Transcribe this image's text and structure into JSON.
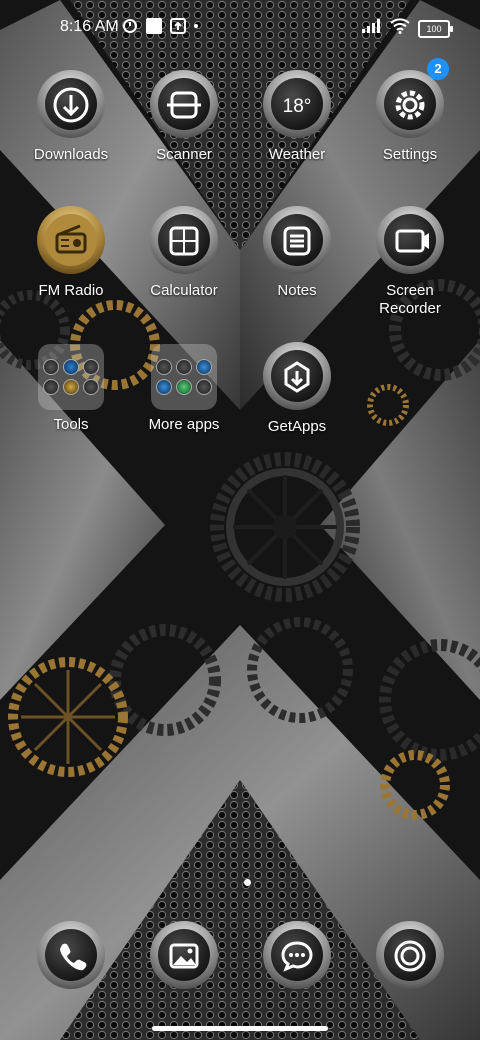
{
  "status_bar": {
    "time": "8:16 AM",
    "battery": "100",
    "icons": [
      "alarm-icon",
      "square-notification-icon",
      "upload-icon",
      "signal-icon",
      "wifi-icon",
      "battery-icon"
    ]
  },
  "apps": {
    "row1": [
      {
        "label": "Downloads",
        "icon": "download-icon"
      },
      {
        "label": "Scanner",
        "icon": "scanner-icon"
      },
      {
        "label": "Weather",
        "icon": "weather-icon",
        "icon_text": "18°"
      },
      {
        "label": "Settings",
        "icon": "gear-icon",
        "badge": "2"
      }
    ],
    "row2": [
      {
        "label": "FM Radio",
        "icon": "radio-icon"
      },
      {
        "label": "Calculator",
        "icon": "calculator-icon"
      },
      {
        "label": "Notes",
        "icon": "notes-icon"
      },
      {
        "label": "Screen\nRecorder",
        "icon": "screen-recorder-icon"
      }
    ],
    "row3": [
      {
        "label": "Tools",
        "icon": "folder-icon"
      },
      {
        "label": "More apps",
        "icon": "folder-icon"
      },
      {
        "label": "GetApps",
        "icon": "getapps-icon"
      }
    ]
  },
  "dock": [
    {
      "icon": "phone-icon"
    },
    {
      "icon": "gallery-icon"
    },
    {
      "icon": "messages-icon"
    },
    {
      "icon": "camera-icon"
    }
  ],
  "colors": {
    "badge": "#1e90ff",
    "metal": "#9a9a9a",
    "gold": "#b08a3c"
  }
}
